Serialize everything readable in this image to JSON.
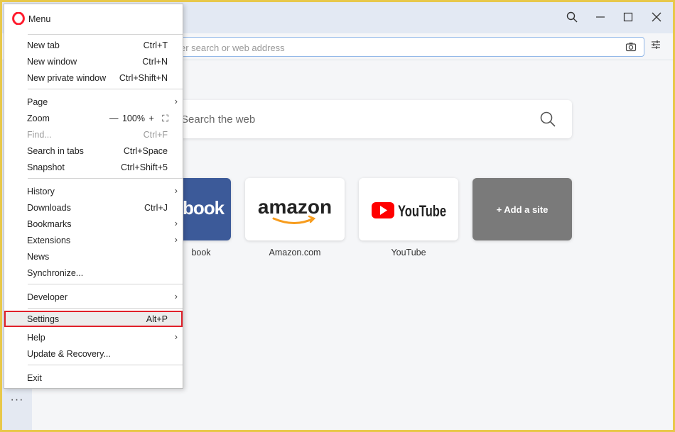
{
  "window": {
    "tab_label": "",
    "controls": {
      "search": "search-icon",
      "minimize": "minimize-icon",
      "maximize": "maximize-icon",
      "close": "close-icon"
    }
  },
  "address_bar": {
    "placeholder": "er search or web address"
  },
  "speed_dial": {
    "search_placeholder": "Search the web",
    "tiles": [
      {
        "title": "book",
        "logo_text": "book",
        "color": "#3c5a99"
      },
      {
        "title": "Amazon.com",
        "logo_text": "amazon"
      },
      {
        "title": "YouTube",
        "logo_text": "YouTube",
        "color": "#ff0000"
      },
      {
        "title": "+ Add a site",
        "color": "#7a7a7a"
      }
    ]
  },
  "sidebar": {
    "more_label": "···"
  },
  "menu": {
    "title": "Menu",
    "items": {
      "new_tab": {
        "label": "New tab",
        "shortcut": "Ctrl+T"
      },
      "new_window": {
        "label": "New window",
        "shortcut": "Ctrl+N"
      },
      "new_private_window": {
        "label": "New private window",
        "shortcut": "Ctrl+Shift+N"
      },
      "page": {
        "label": "Page",
        "arrow": "›"
      },
      "zoom": {
        "label": "Zoom",
        "minus": "—",
        "value": "100%",
        "plus": "+",
        "fullscreen": "⛶"
      },
      "find": {
        "label": "Find...",
        "shortcut": "Ctrl+F"
      },
      "search_in_tabs": {
        "label": "Search in tabs",
        "shortcut": "Ctrl+Space"
      },
      "snapshot": {
        "label": "Snapshot",
        "shortcut": "Ctrl+Shift+5"
      },
      "history": {
        "label": "History",
        "arrow": "›"
      },
      "downloads": {
        "label": "Downloads",
        "shortcut": "Ctrl+J"
      },
      "bookmarks": {
        "label": "Bookmarks",
        "arrow": "›"
      },
      "extensions": {
        "label": "Extensions",
        "arrow": "›"
      },
      "news": {
        "label": "News"
      },
      "synchronize": {
        "label": "Synchronize..."
      },
      "developer": {
        "label": "Developer",
        "arrow": "›"
      },
      "settings": {
        "label": "Settings",
        "shortcut": "Alt+P"
      },
      "help": {
        "label": "Help",
        "arrow": "›"
      },
      "update_recovery": {
        "label": "Update & Recovery..."
      },
      "exit": {
        "label": "Exit"
      }
    }
  },
  "colors": {
    "brand": "#ff1b2d",
    "highlight_border": "#e0202a",
    "accent": "#8fb6e8"
  }
}
